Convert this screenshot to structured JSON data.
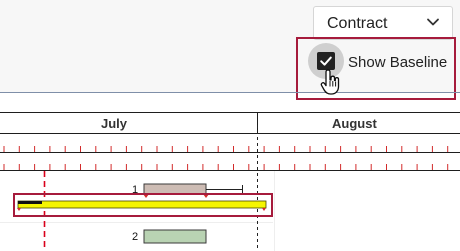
{
  "toolbar": {
    "view_dropdown": {
      "selected": "Contract",
      "icon": "chevron-down-icon"
    },
    "show_baseline": {
      "label": "Show Baseline",
      "checked": true,
      "icon": "check-icon"
    }
  },
  "timeline": {
    "months": [
      "July",
      "August"
    ]
  },
  "tasks": [
    {
      "label": "1",
      "has_baseline": true
    },
    {
      "label": "2",
      "has_baseline": false
    }
  ],
  "colors": {
    "accent_highlight": "#a61b3c",
    "task_bar_1": "#cdbcb4",
    "task_bar_2": "#b9d3b3",
    "baseline_bar": "#f5f500",
    "today_marker": "#d9001b",
    "header_grid": "#1e1e1e",
    "ticks": "#d22b2b"
  }
}
